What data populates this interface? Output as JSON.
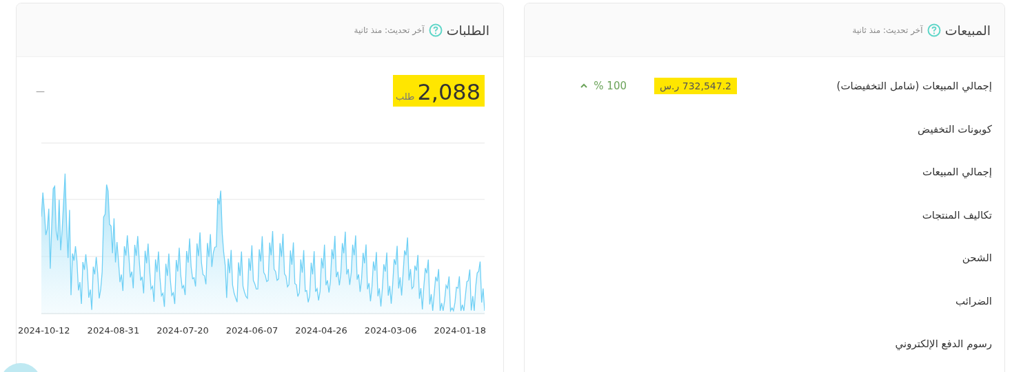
{
  "panels": [
    {
      "kind": "list",
      "title": "المبيعات",
      "updated": "آخر تحديث: منذ ثانية",
      "rows": [
        {
          "label": "إجمالي المبيعات (شامل التخفيضات)",
          "value": "732,547.2",
          "currency": "ر.س",
          "change": "100 %",
          "rising": true,
          "highlighted": true
        },
        {
          "label": "كوبونات التخفيض"
        },
        {
          "label": "إجمالي المبيعات"
        },
        {
          "label": "تكاليف المنتجات"
        },
        {
          "label": "الشحن"
        },
        {
          "label": "الضرائب"
        },
        {
          "label": "رسوم الدفع الإلكتروني"
        }
      ]
    },
    {
      "kind": "chart",
      "title": "الطلبات",
      "updated": "آخر تحديث: منذ ثانية",
      "total": "2,088",
      "unit": "طلب",
      "change": "—",
      "highlighted": true,
      "x_labels": [
        "2024-01-18",
        "2024-03-06",
        "2024-04-26",
        "2024-06-07",
        "2024-07-20",
        "2024-08-31",
        "2024-10-12"
      ]
    }
  ]
}
